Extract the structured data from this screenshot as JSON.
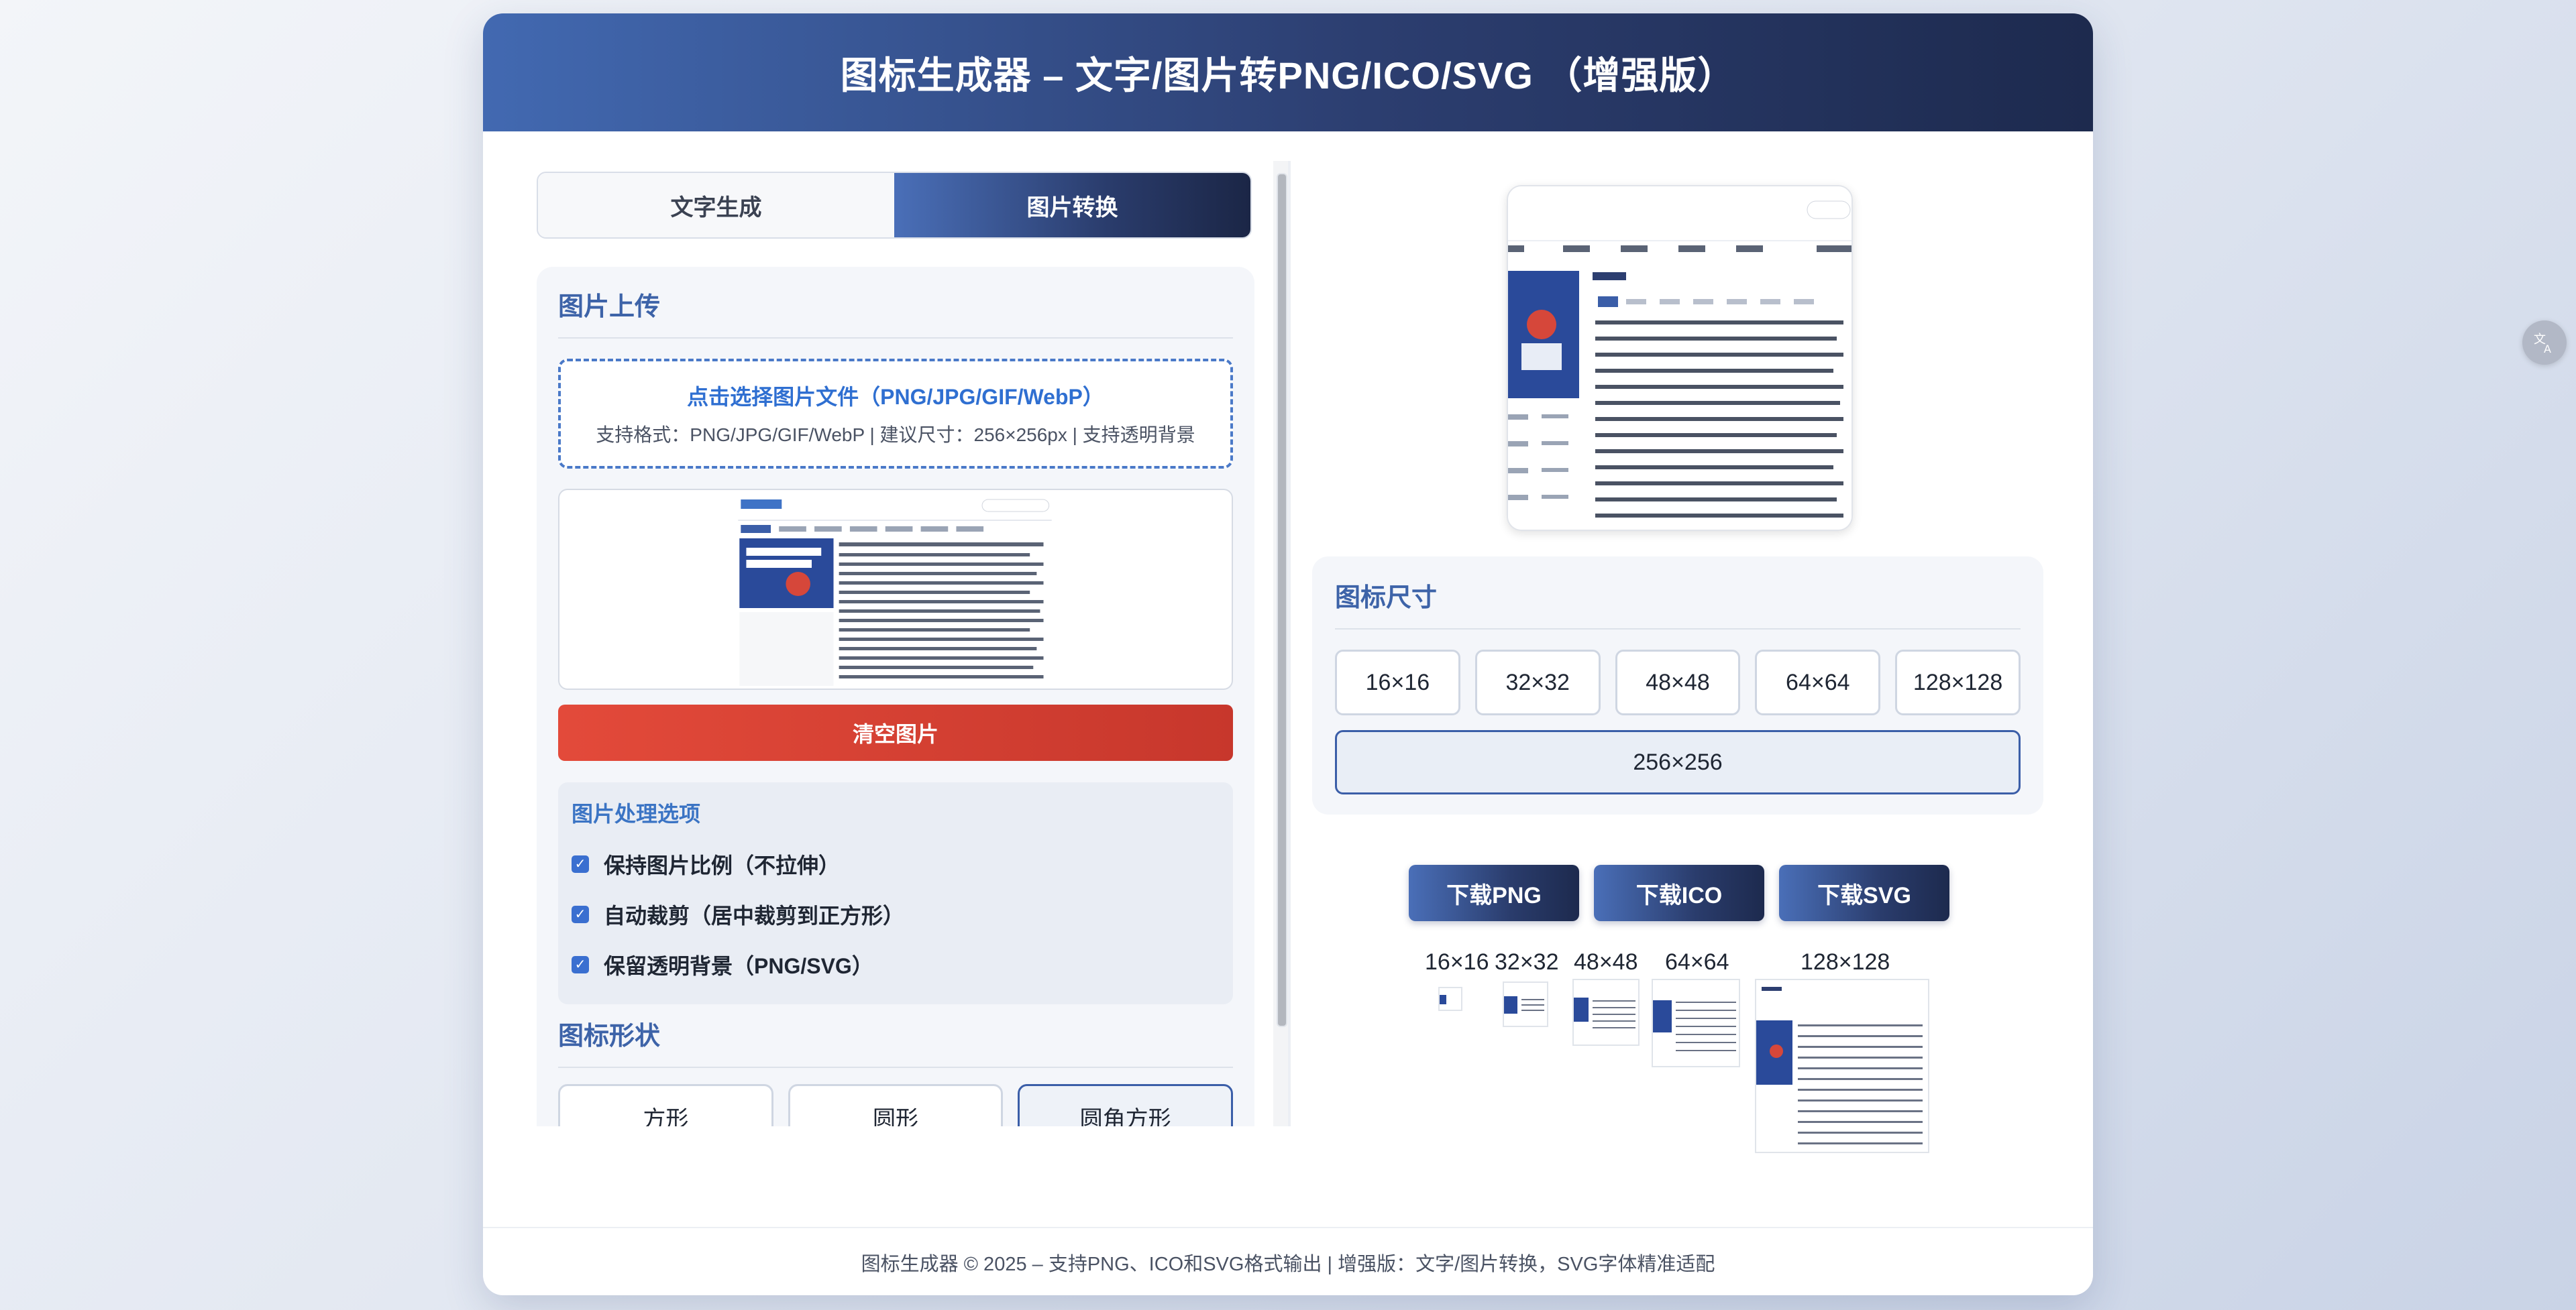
{
  "header": {
    "title": "图标生成器 – 文字/图片转PNG/ICO/SVG （增强版）"
  },
  "tabs": [
    {
      "label": "文字生成",
      "active": false
    },
    {
      "label": "图片转换",
      "active": true
    }
  ],
  "upload": {
    "section_title": "图片上传",
    "choose_label": "点击选择图片文件（PNG/JPG/GIF/WebP）",
    "hint": "支持格式：PNG/JPG/GIF/WebP | 建议尺寸：256×256px | 支持透明背景",
    "clear_label": "清空图片"
  },
  "processing": {
    "title": "图片处理选项",
    "options": [
      {
        "label": "保持图片比例（不拉伸）",
        "checked": true
      },
      {
        "label": "自动裁剪（居中裁剪到正方形）",
        "checked": true
      },
      {
        "label": "保留透明背景（PNG/SVG）",
        "checked": true
      }
    ]
  },
  "shape": {
    "title": "图标形状",
    "options": [
      "方形",
      "圆形",
      "圆角方形"
    ],
    "selected": "圆角方形"
  },
  "size": {
    "title": "图标尺寸",
    "options": [
      "16×16",
      "32×32",
      "48×48",
      "64×64",
      "128×128",
      "256×256"
    ],
    "selected": "256×256"
  },
  "downloads": [
    "下载PNG",
    "下载ICO",
    "下载SVG"
  ],
  "thumbnails": [
    "16×16",
    "32×32",
    "48×48",
    "64×64",
    "128×128"
  ],
  "footer": {
    "text": "图标生成器 © 2025 – 支持PNG、ICO和SVG格式输出 | 增强版：文字/图片转换，SVG字体精准适配"
  },
  "colors": {
    "accent": "#3b5ea8",
    "danger": "#d9412f",
    "header_dark": "#1d2a4e",
    "link_blue": "#2f6fd1"
  },
  "float_icon": "translate-icon"
}
